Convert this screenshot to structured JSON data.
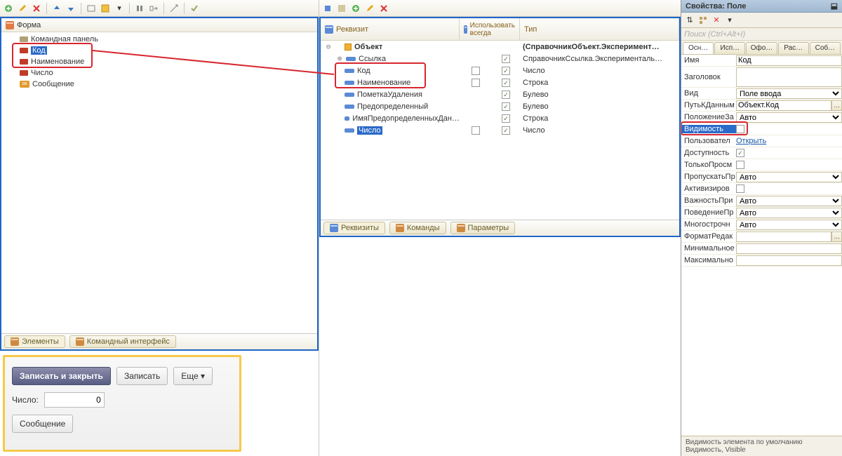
{
  "form_panel": {
    "title": "Форма",
    "items": [
      {
        "label": "Командная панель",
        "kind": "cmd"
      },
      {
        "label": "Код",
        "kind": "field",
        "selected": true
      },
      {
        "label": "Наименование",
        "kind": "field"
      },
      {
        "label": "Число",
        "kind": "field"
      },
      {
        "label": "Сообщение",
        "kind": "ok"
      }
    ],
    "tab_elements": "Элементы",
    "tab_cmdiface": "Командный интерфейс"
  },
  "preview": {
    "btn_save_close": "Записать и закрыть",
    "btn_save": "Записать",
    "btn_more": "Еще",
    "lbl_number": "Число:",
    "val_number": "0",
    "btn_msg": "Сообщение"
  },
  "req_panel": {
    "col_req": "Реквизит",
    "col_always": "Использовать всегда",
    "col_type": "Тип",
    "root": "Объект",
    "root_type": "(СправочникОбъект.Эксперимент…",
    "rows": [
      {
        "name": "Ссылка",
        "type": "СправочникСсылка.Эксперименталь…",
        "c3": true,
        "expand": true
      },
      {
        "name": "Код",
        "type": "Число",
        "c2": true,
        "c3": true
      },
      {
        "name": "Наименование",
        "type": "Строка",
        "c2": true,
        "c3": true
      },
      {
        "name": "ПометкаУдаления",
        "type": "Булево",
        "c3": true
      },
      {
        "name": "Предопределенный",
        "type": "Булево",
        "c3": true
      },
      {
        "name": "ИмяПредопределенныхДан…",
        "type": "Строка",
        "c3": true
      },
      {
        "name": "Число",
        "type": "Число",
        "c2": true,
        "c3": true,
        "selected": true
      }
    ],
    "tab_reqs": "Реквизиты",
    "tab_cmds": "Команды",
    "tab_params": "Параметры"
  },
  "props": {
    "title": "Свойства: Поле",
    "search_ph": "Поиск (Ctrl+Alt+I)",
    "tabs": [
      "Осн…",
      "Исп…",
      "Офо…",
      "Рас…",
      "Соб…"
    ],
    "rows": {
      "name_l": "Имя",
      "name_v": "Код",
      "title_l": "Заголовок",
      "title_v": "",
      "kind_l": "Вид",
      "kind_v": "Поле ввода",
      "path_l": "ПутьКДанным",
      "path_v": "Объект.Код",
      "pos_l": "ПоложениеЗа",
      "pos_v": "Авто",
      "vis_l": "Видимость",
      "usr_l": "Пользовател",
      "usr_v": "Открыть",
      "avail_l": "Доступность",
      "ro_l": "ТолькоПросм",
      "skip_l": "ПропускатьПр",
      "skip_v": "Авто",
      "act_l": "Активизиров",
      "imp_l": "ВажностьПри",
      "imp_v": "Авто",
      "beh_l": "ПоведениеПр",
      "beh_v": "Авто",
      "multi_l": "Многострочн",
      "multi_v": "Авто",
      "fmt_l": "ФорматРедак",
      "min_l": "Минимальное",
      "max_l": "Максимально"
    },
    "footer1": "Видимость элемента по умолчанию",
    "footer2": "Видимость, Visible"
  }
}
